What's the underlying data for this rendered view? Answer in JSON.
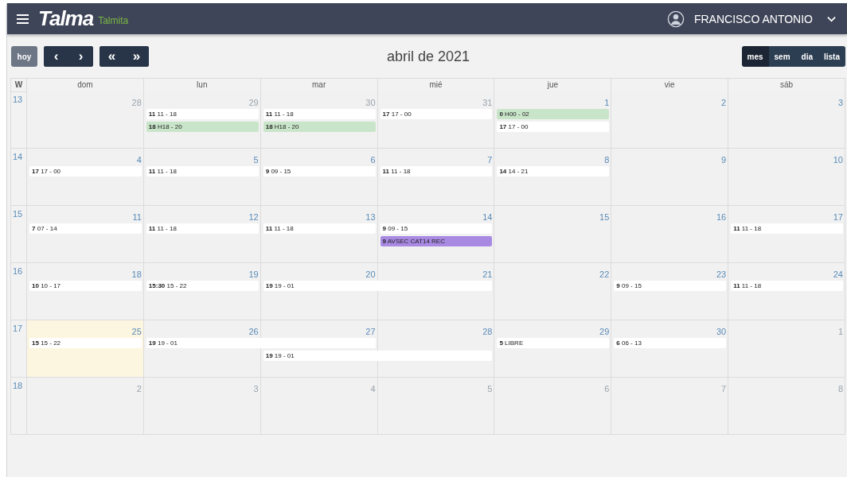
{
  "header": {
    "brand": "Talma",
    "subtitle": "Talmita",
    "user": "FRANCISCO ANTONIO"
  },
  "toolbar": {
    "today_button": "hoy",
    "prev": "‹",
    "next": "›",
    "prev_year": "«",
    "next_year": "»",
    "title": "abril de 2021",
    "views": [
      {
        "label": "mes",
        "selected": true
      },
      {
        "label": "sem",
        "selected": false
      },
      {
        "label": "dia",
        "selected": false
      },
      {
        "label": "lista",
        "selected": false
      }
    ]
  },
  "calendar": {
    "week_heading": "W",
    "weekdays": [
      "dom",
      "lun",
      "mar",
      "mié",
      "jue",
      "vie",
      "sáb"
    ],
    "weeks": [
      {
        "number": "13",
        "days": [
          {
            "number": "28",
            "other_month": true,
            "today": false
          },
          {
            "number": "29",
            "other_month": true,
            "today": false,
            "events": [
              {
                "label": "**11** 11 - 18",
                "color": "#ffffff"
              },
              {
                "label": "**18** H18 - 20",
                "color": "#c9e5c9"
              }
            ]
          },
          {
            "number": "30",
            "other_month": true,
            "today": false,
            "events": [
              {
                "label": "**11** 11 - 18",
                "color": "#ffffff"
              },
              {
                "label": "**18** H18 - 20",
                "color": "#c9e5c9"
              }
            ]
          },
          {
            "number": "31",
            "other_month": true,
            "today": false,
            "events": [
              {
                "label": "**17** 17 - 00",
                "color": "#ffffff"
              }
            ]
          },
          {
            "number": "1",
            "other_month": false,
            "today": false,
            "events": [
              {
                "label": "**0** H00 - 02",
                "color": "#c9e5c9"
              },
              {
                "label": "**17** 17 - 00",
                "color": "#ffffff"
              }
            ]
          },
          {
            "number": "2",
            "other_month": false,
            "today": false
          },
          {
            "number": "3",
            "other_month": false,
            "today": false
          }
        ]
      },
      {
        "number": "14",
        "days": [
          {
            "number": "4",
            "other_month": false,
            "today": false,
            "events": [
              {
                "label": "**17** 17 - 00",
                "color": "#ffffff"
              }
            ]
          },
          {
            "number": "5",
            "other_month": false,
            "today": false,
            "events": [
              {
                "label": "**11** 11 - 18",
                "color": "#ffffff"
              }
            ]
          },
          {
            "number": "6",
            "other_month": false,
            "today": false,
            "events": [
              {
                "label": "**9** 09 - 15",
                "color": "#ffffff"
              }
            ]
          },
          {
            "number": "7",
            "other_month": false,
            "today": false,
            "events": [
              {
                "label": "**11** 11 - 18",
                "color": "#ffffff"
              }
            ]
          },
          {
            "number": "8",
            "other_month": false,
            "today": false,
            "events": [
              {
                "label": "**14** 14 - 21",
                "color": "#ffffff"
              }
            ]
          },
          {
            "number": "9",
            "other_month": false,
            "today": false
          },
          {
            "number": "10",
            "other_month": false,
            "today": false
          }
        ]
      },
      {
        "number": "15",
        "days": [
          {
            "number": "11",
            "other_month": false,
            "today": false,
            "events": [
              {
                "label": "**7** 07 - 14",
                "color": "#ffffff"
              }
            ]
          },
          {
            "number": "12",
            "other_month": false,
            "today": false,
            "events": [
              {
                "label": "**11** 11 - 18",
                "color": "#ffffff"
              }
            ]
          },
          {
            "number": "13",
            "other_month": false,
            "today": false,
            "events": [
              {
                "label": "**11** 11 - 18",
                "color": "#ffffff"
              }
            ]
          },
          {
            "number": "14",
            "other_month": false,
            "today": false,
            "events": [
              {
                "label": "**9** 09 - 15",
                "color": "#ffffff"
              },
              {
                "label": "**9** AVSEC CAT14 REC",
                "color": "#a98ae3"
              }
            ]
          },
          {
            "number": "15",
            "other_month": false,
            "today": false
          },
          {
            "number": "16",
            "other_month": false,
            "today": false
          },
          {
            "number": "17",
            "other_month": false,
            "today": false,
            "events": [
              {
                "label": "**11** 11 - 18",
                "color": "#ffffff"
              }
            ]
          }
        ]
      },
      {
        "number": "16",
        "days": [
          {
            "number": "18",
            "other_month": false,
            "today": false,
            "events": [
              {
                "label": "**10** 10 - 17",
                "color": "#ffffff"
              }
            ]
          },
          {
            "number": "19",
            "other_month": false,
            "today": false,
            "events": [
              {
                "label": "**15:30** 15 - 22",
                "color": "#ffffff"
              }
            ]
          },
          {
            "number": "20",
            "other_month": false,
            "today": false,
            "events": [
              {
                "label": "**19** 19 - 01",
                "color": "#ffffff",
                "continues_next_day": true
              }
            ]
          },
          {
            "number": "21",
            "other_month": false,
            "today": false
          },
          {
            "number": "22",
            "other_month": false,
            "today": false
          },
          {
            "number": "23",
            "other_month": false,
            "today": false,
            "events": [
              {
                "label": "**9** 09 - 15",
                "color": "#ffffff"
              }
            ]
          },
          {
            "number": "24",
            "other_month": false,
            "today": false,
            "events": [
              {
                "label": "**11** 11 - 18",
                "color": "#ffffff"
              }
            ]
          }
        ]
      },
      {
        "number": "17",
        "days": [
          {
            "number": "25",
            "other_month": false,
            "today": true,
            "events": [
              {
                "label": "**15** 15 - 22",
                "color": "#ffffff"
              }
            ]
          },
          {
            "number": "26",
            "other_month": false,
            "today": false,
            "events": [
              {
                "label": "**19** 19 - 01",
                "color": "#ffffff",
                "continues_next_day": true
              }
            ]
          },
          {
            "number": "27",
            "other_month": false,
            "today": false,
            "events": [
              {
                "label": "**19** 19 - 01",
                "color": "#ffffff",
                "continues_next_day": true
              }
            ]
          },
          {
            "number": "28",
            "other_month": false,
            "today": false
          },
          {
            "number": "29",
            "other_month": false,
            "today": false,
            "events": [
              {
                "label": "**5** LIBRE",
                "color": "#ffffff"
              }
            ]
          },
          {
            "number": "30",
            "other_month": false,
            "today": false,
            "events": [
              {
                "label": "**6** 06 - 13",
                "color": "#ffffff"
              }
            ]
          },
          {
            "number": "1",
            "other_month": true,
            "today": false
          }
        ]
      },
      {
        "number": "18",
        "days": [
          {
            "number": "2",
            "other_month": true,
            "today": false
          },
          {
            "number": "3",
            "other_month": true,
            "today": false
          },
          {
            "number": "4",
            "other_month": true,
            "today": false
          },
          {
            "number": "5",
            "other_month": true,
            "today": false
          },
          {
            "number": "6",
            "other_month": true,
            "today": false
          },
          {
            "number": "7",
            "other_month": true,
            "today": false
          },
          {
            "number": "8",
            "other_month": true,
            "today": false
          }
        ]
      }
    ]
  }
}
